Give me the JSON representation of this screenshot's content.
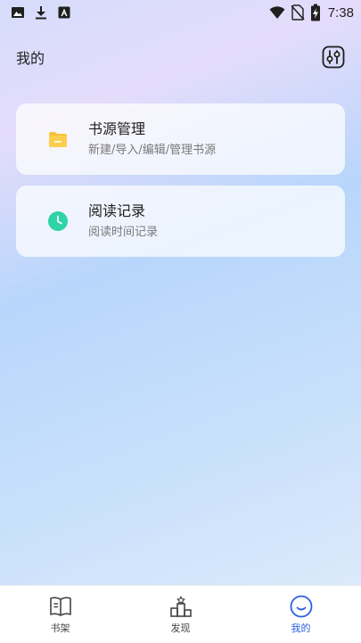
{
  "status_bar": {
    "time": "7:38",
    "left_icons": [
      "image-icon",
      "download-icon",
      "font-icon"
    ],
    "right_icons": [
      "wifi-icon",
      "no-sim-icon",
      "battery-charging-icon"
    ]
  },
  "header": {
    "title": "我的",
    "settings_icon": "settings-sliders-icon"
  },
  "menu": [
    {
      "title": "书源管理",
      "subtitle": "新建/导入/编辑/管理书源",
      "icon": "folder-icon",
      "icon_color": "#f8c23a"
    },
    {
      "title": "阅读记录",
      "subtitle": "阅读时间记录",
      "icon": "clock-icon",
      "icon_color": "#2ed3a6"
    }
  ],
  "bottom_nav": {
    "active": "我的",
    "items": [
      {
        "label": "书架",
        "icon": "book-icon"
      },
      {
        "label": "发现",
        "icon": "podium-icon"
      },
      {
        "label": "我的",
        "icon": "smile-icon"
      }
    ],
    "active_color": "#2b5fe0"
  }
}
